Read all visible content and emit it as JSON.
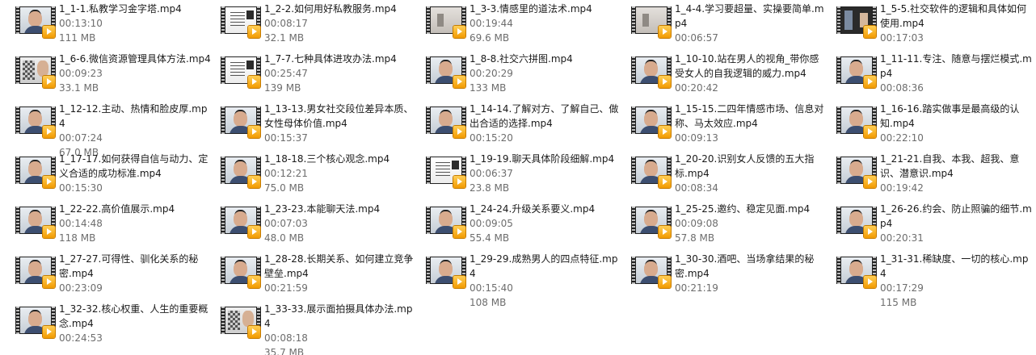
{
  "files": [
    {
      "name": "1_1-1.私教学习金字塔.mp4",
      "duration": "00:13:10",
      "size": "111 MB",
      "thumb": "face"
    },
    {
      "name": "1_2-2.如何用好私教服务.mp4",
      "duration": "00:08:17",
      "size": "32.1 MB",
      "thumb": "slide"
    },
    {
      "name": "1_3-3.情感里的道法术.mp4",
      "duration": "00:19:44",
      "size": "69.6 MB",
      "thumb": "light"
    },
    {
      "name": "1_4-4.学习要超量、实操要简单.mp4",
      "duration": "00:06:57",
      "size": "",
      "thumb": "light"
    },
    {
      "name": "1_5-5.社交软件的逻辑和具体如何使用.mp4",
      "duration": "00:17:03",
      "size": "",
      "thumb": "dark"
    },
    {
      "name": "1_6-6.微信资源管理具体方法.mp4",
      "duration": "00:09:23",
      "size": "33.1 MB",
      "thumb": "sq"
    },
    {
      "name": "1_7-7.七种具体进攻办法.mp4",
      "duration": "00:25:47",
      "size": "139 MB",
      "thumb": "slide"
    },
    {
      "name": "1_8-8.社交六拼图.mp4",
      "duration": "00:20:29",
      "size": "133 MB",
      "thumb": "face"
    },
    {
      "name": "1_10-10.站在男人的视角_带你感受女人的自我逻辑的威力.mp4",
      "duration": "00:20:42",
      "size": "",
      "thumb": "face"
    },
    {
      "name": "1_11-11.专注、随意与摆烂模式.mp4",
      "duration": "00:08:36",
      "size": "",
      "thumb": "face"
    },
    {
      "name": "1_12-12.主动、热情和脸皮厚.mp4",
      "duration": "00:07:24",
      "size": "67.0 MB",
      "thumb": "face"
    },
    {
      "name": "1_13-13.男女社交段位差异本质、女性母体价值.mp4",
      "duration": "00:15:37",
      "size": "",
      "thumb": "face"
    },
    {
      "name": "1_14-14.了解对方、了解自己、做出合适的选择.mp4",
      "duration": "00:15:20",
      "size": "",
      "thumb": "face"
    },
    {
      "name": "1_15-15.二四年情感市场、信息对称、马太效应.mp4",
      "duration": "00:09:13",
      "size": "",
      "thumb": "face"
    },
    {
      "name": "1_16-16.踏实做事是最高级的认知.mp4",
      "duration": "00:22:10",
      "size": "",
      "thumb": "face"
    },
    {
      "name": "1_17-17.如何获得自信与动力、定义合适的成功标准.mp4",
      "duration": "00:15:30",
      "size": "",
      "thumb": "face"
    },
    {
      "name": "1_18-18.三个核心观念.mp4",
      "duration": "00:12:21",
      "size": "75.0 MB",
      "thumb": "face"
    },
    {
      "name": "1_19-19.聊天具体阶段细解.mp4",
      "duration": "00:06:37",
      "size": "23.8 MB",
      "thumb": "slide"
    },
    {
      "name": "1_20-20.识别女人反馈的五大指标.mp4",
      "duration": "00:08:34",
      "size": "",
      "thumb": "face"
    },
    {
      "name": "1_21-21.自我、本我、超我、意识、潜意识.mp4",
      "duration": "00:19:42",
      "size": "",
      "thumb": "face"
    },
    {
      "name": "1_22-22.高价值展示.mp4",
      "duration": "00:14:48",
      "size": "118 MB",
      "thumb": "face"
    },
    {
      "name": "1_23-23.本能聊天法.mp4",
      "duration": "00:07:03",
      "size": "48.0 MB",
      "thumb": "face"
    },
    {
      "name": "1_24-24.升级关系要义.mp4",
      "duration": "00:09:05",
      "size": "55.4 MB",
      "thumb": "face"
    },
    {
      "name": "1_25-25.邀约、稳定见面.mp4",
      "duration": "00:09:08",
      "size": "57.8 MB",
      "thumb": "face"
    },
    {
      "name": "1_26-26.约会、防止照骗的细节.mp4",
      "duration": "00:20:31",
      "size": "",
      "thumb": "face"
    },
    {
      "name": "1_27-27.可得性、驯化关系的秘密.mp4",
      "duration": "00:23:09",
      "size": "",
      "thumb": "face"
    },
    {
      "name": "1_28-28.长期关系、如何建立竞争壁垒.mp4",
      "duration": "00:21:59",
      "size": "",
      "thumb": "face"
    },
    {
      "name": "1_29-29.成熟男人的四点特征.mp4",
      "duration": "00:15:40",
      "size": "108 MB",
      "thumb": "face"
    },
    {
      "name": "1_30-30.酒吧、当场拿结果的秘密.mp4",
      "duration": "00:21:19",
      "size": "",
      "thumb": "face"
    },
    {
      "name": "1_31-31.稀缺度、一切的核心.mp4",
      "duration": "00:17:29",
      "size": "115 MB",
      "thumb": "face"
    },
    {
      "name": "1_32-32.核心权重、人生的重要概念.mp4",
      "duration": "00:24:53",
      "size": "",
      "thumb": "face"
    },
    {
      "name": "1_33-33.展示面拍摄具体办法.mp4",
      "duration": "00:08:18",
      "size": "35.7 MB",
      "thumb": "sq"
    }
  ]
}
